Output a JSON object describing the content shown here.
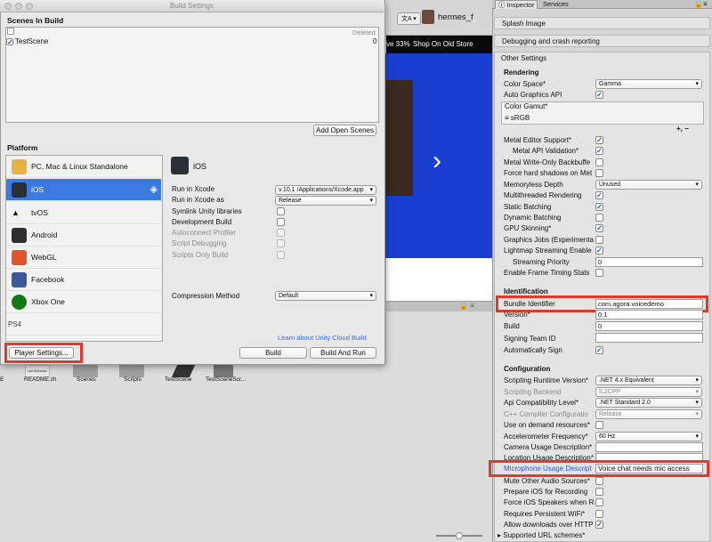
{
  "window": {
    "title": "Build Settings"
  },
  "scenes": {
    "header": "Scenes In Build",
    "deleted_label": "Deleted",
    "items": [
      {
        "name": "TestScene",
        "index": "0"
      }
    ],
    "add_open_scenes": "Add Open Scenes"
  },
  "platform": {
    "header": "Platform",
    "items": [
      {
        "label": "PC, Mac & Linux Standalone",
        "icon": "unity-icon"
      },
      {
        "label": "iOS",
        "icon": "ios-icon",
        "selected": true
      },
      {
        "label": "tvOS",
        "icon": "tvos-icon"
      },
      {
        "label": "Android",
        "icon": "android-icon"
      },
      {
        "label": "WebGL",
        "icon": "html5-icon"
      },
      {
        "label": "Facebook",
        "icon": "facebook-icon"
      },
      {
        "label": "Xbox One",
        "icon": "xbox-icon"
      },
      {
        "label": "PS4",
        "icon": "ps4-icon"
      }
    ],
    "selected_title": "iOS"
  },
  "ios_settings": {
    "run_in_xcode_label": "Run in Xcode",
    "run_in_xcode_value": "v.10.1    /Applications/Xcode.app",
    "run_in_xcode_as_label": "Run in Xcode as",
    "run_in_xcode_as_value": "Release",
    "symlink_label": "Symlink Unity libraries",
    "dev_build_label": "Development Build",
    "autoconnect_label": "Autoconnect Profiler",
    "script_debug_label": "Script Debugging",
    "scripts_only_label": "Scripts Only Build",
    "compression_label": "Compression Method",
    "compression_value": "Default"
  },
  "footer": {
    "cloud_link": "Learn about Unity Cloud Build",
    "player_settings": "Player Settings...",
    "build": "Build",
    "build_and_run": "Build And Run"
  },
  "background": {
    "user_name": "hermes_f",
    "promo_text": "ve 33%",
    "shop_text": "Shop On Old Store",
    "project_items": [
      "E",
      "README.zh",
      "Scenes",
      "Scripts",
      "TestScene",
      "TestSceneScr..."
    ],
    "thumb_text": "qnl dekaraa"
  },
  "inspector": {
    "tabs": {
      "inspector": "Inspector",
      "services": "Services"
    },
    "splash_image": "Splash Image",
    "debugging": "Debugging and crash reporting",
    "other_settings": "Other Settings",
    "rendering": {
      "header": "Rendering",
      "color_space_label": "Color Space*",
      "color_space_value": "Gamma",
      "auto_graphics_api": "Auto Graphics API",
      "color_gamut_label": "Color Gamut*",
      "color_gamut_value": "sRGB",
      "plus_minus": "+,  −",
      "metal_editor_support": "Metal Editor Support*",
      "metal_api_validation": "Metal API Validation*",
      "metal_write_only": "Metal Write-Only Backbuffe",
      "force_hard_shadows": "Force hard shadows on Met",
      "memoryless_depth_label": "Memoryless Depth",
      "memoryless_depth_value": "Unused",
      "multithreaded": "Multithreaded Rendering",
      "static_batching": "Static Batching",
      "dynamic_batching": "Dynamic Batching",
      "gpu_skinning": "GPU Skinning*",
      "graphics_jobs": "Graphics Jobs (Experimenta",
      "lightmap_streaming": "Lightmap Streaming Enable",
      "streaming_priority_label": "Streaming Priority",
      "streaming_priority_value": "0",
      "frame_timing": "Enable Frame Timing Stats"
    },
    "identification": {
      "header": "Identification",
      "bundle_id_label": "Bundle Identifier",
      "bundle_id_value": "com.agora.voicedemo",
      "version_label": "Version*",
      "version_value": "0.1",
      "build_label": "Build",
      "build_value": "0",
      "signing_team_label": "Signing Team ID",
      "signing_team_value": "",
      "auto_sign_label": "Automatically Sign"
    },
    "configuration": {
      "header": "Configuration",
      "runtime_label": "Scripting Runtime Version*",
      "runtime_value": ".NET 4.x Equivalent",
      "backend_label": "Scripting Backend",
      "backend_value": "IL2CPP",
      "api_label": "Api Compatibility Level*",
      "api_value": ".NET Standard 2.0",
      "cpp_label": "C++ Compiler Configuratio",
      "cpp_value": "Release",
      "on_demand": "Use on demand resources*",
      "accel_label": "Accelerometer Frequency*",
      "accel_value": "60 Hz",
      "camera_label": "Camera Usage Description*",
      "location_label": "Location Usage Description*",
      "mic_label": "Microphone Usage Descript",
      "mic_value": "Voice chat needs mic access",
      "mute_audio": "Mute Other Audio Sources*",
      "prepare_ios": "Prepare iOS for Recording",
      "force_speakers": "Force iOS Speakers when Re",
      "requires_wifi": "Requires Persistent WiFi*",
      "allow_http": "Allow downloads over HTTP",
      "supported_urls": "Supported URL schemes*"
    }
  },
  "colors": {
    "accent": "#3d7ae0",
    "highlight": "#e03a2a",
    "link": "#3a6fd8"
  }
}
